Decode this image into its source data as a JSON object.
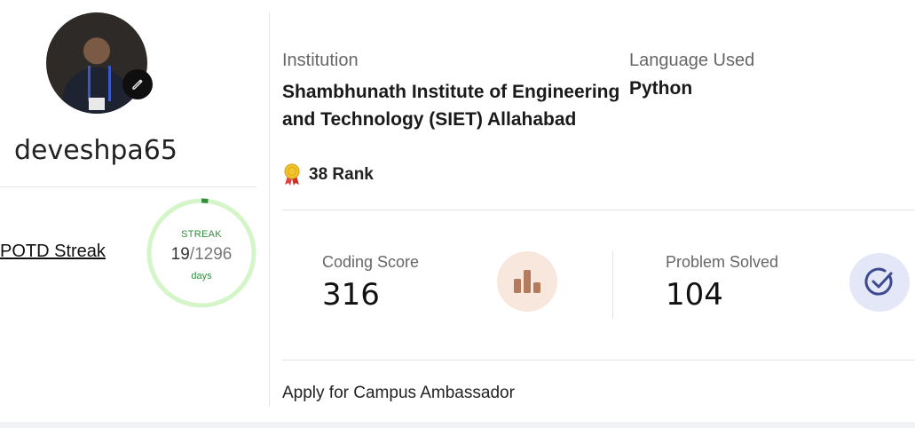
{
  "profile": {
    "username": "deveshpa65",
    "avatar_alt": "profile photo",
    "edit_icon": "pencil-icon"
  },
  "streak": {
    "link_label": "POTD Streak",
    "label": "STREAK",
    "current": "19",
    "total": "/1296",
    "unit": "days",
    "progress": 0.0147,
    "ring_color": "#d3f5c8",
    "progress_color": "#2f8f3d"
  },
  "institution": {
    "label": "Institution",
    "name": "Shambhunath Institute of Engineering and Technology (SIET) Allahabad",
    "rank_icon": "medal-icon",
    "rank": "38 Rank"
  },
  "language": {
    "label": "Language Used",
    "value": "Python"
  },
  "stats": {
    "coding_score": {
      "label": "Coding Score",
      "value": "316",
      "icon": "bar-chart-icon",
      "icon_color": "#b47a5c"
    },
    "problems_solved": {
      "label": "Problem Solved",
      "value": "104",
      "icon": "check-circle-icon",
      "icon_color": "#3d4a8f"
    }
  },
  "links": {
    "ambassador": "Apply for Campus Ambassador"
  }
}
